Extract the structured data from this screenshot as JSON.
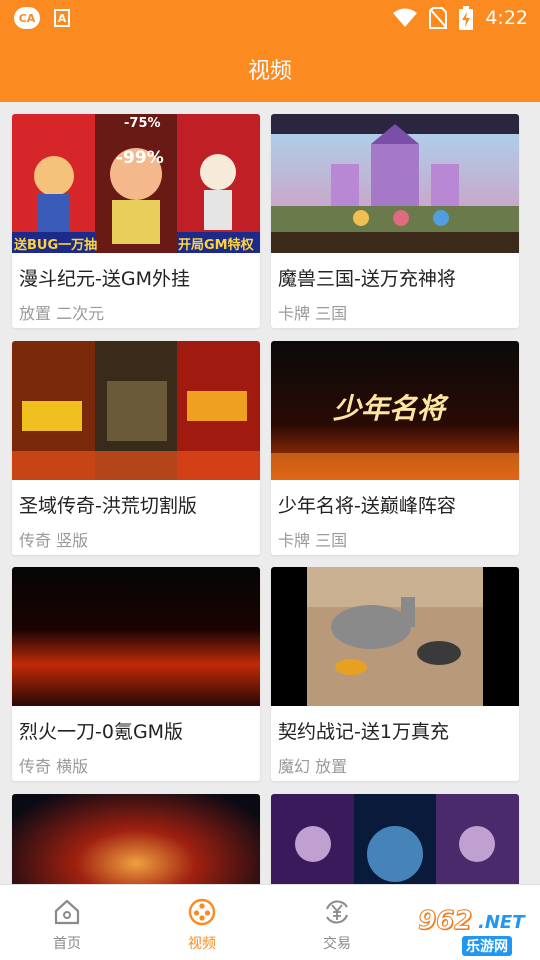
{
  "status_bar": {
    "app_icon_text": "CA",
    "a_icon_text": "A",
    "time": "4:22",
    "icons": [
      "wifi-icon",
      "no-sim-icon",
      "battery-charging-icon"
    ]
  },
  "header": {
    "title": "视频"
  },
  "videos": [
    {
      "title": "漫斗纪元-送GM外挂",
      "tags": "放置 二次元"
    },
    {
      "title": "魔兽三国-送万充神将",
      "tags": "卡牌 三国"
    },
    {
      "title": "圣域传奇-洪荒切割版",
      "tags": "传奇 竖版"
    },
    {
      "title": "少年名将-送巅峰阵容",
      "tags": "卡牌 三国"
    },
    {
      "title": "烈火一刀-0氪GM版",
      "tags": "传奇 横版"
    },
    {
      "title": "契约战记-送1万真充",
      "tags": "魔幻 放置"
    },
    {
      "title": "",
      "tags": ""
    },
    {
      "title": "",
      "tags": ""
    }
  ],
  "thumb_text": {
    "t1_left": "送BUG一万抽",
    "t1_right": "开局GM特权",
    "t1_pct1": "-99%",
    "t1_pct2": "-75%",
    "t4_logo": "少年名将"
  },
  "tabs": [
    {
      "label": "首页",
      "icon": "home-icon",
      "active": false
    },
    {
      "label": "视频",
      "icon": "video-reel-icon",
      "active": true
    },
    {
      "label": "交易",
      "icon": "yen-exchange-icon",
      "active": false
    }
  ],
  "watermark": {
    "number": "962",
    "net": ".NET",
    "sub": "乐游网"
  },
  "colors": {
    "accent": "#fb8a20",
    "background": "#ececec",
    "tag_text": "#9a9a9a"
  }
}
